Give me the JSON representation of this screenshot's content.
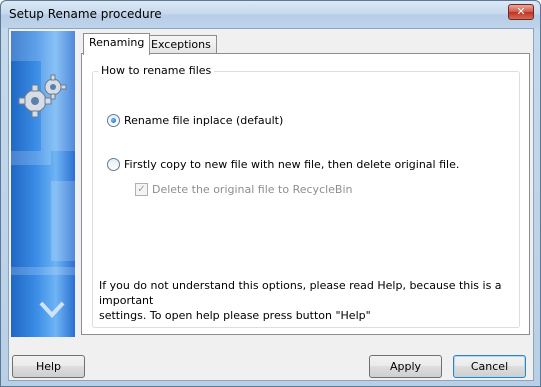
{
  "window": {
    "title": "Setup Rename procedure",
    "close_label": "✕"
  },
  "tabs": [
    {
      "label": "Renaming",
      "active": true
    },
    {
      "label": "Exceptions",
      "active": false
    }
  ],
  "group": {
    "legend": "How to rename files",
    "options": [
      {
        "label": "Rename file inplace (default)",
        "checked": true
      },
      {
        "label": "Firstly copy to new file with new file, then delete original file.",
        "checked": false
      }
    ],
    "checkbox": {
      "label": "Delete the original file to RecycleBin",
      "checked": true,
      "enabled": false
    }
  },
  "info": {
    "line1": "If you do not understand this options, please read Help, because this is a important",
    "line2": "settings. To open help please press button \"Help\""
  },
  "buttons": {
    "help": "Help",
    "apply": "Apply",
    "cancel": "Cancel"
  },
  "icons": {
    "banner_gear": "gear-icon",
    "banner_chevron": "chevron-down-icon"
  }
}
